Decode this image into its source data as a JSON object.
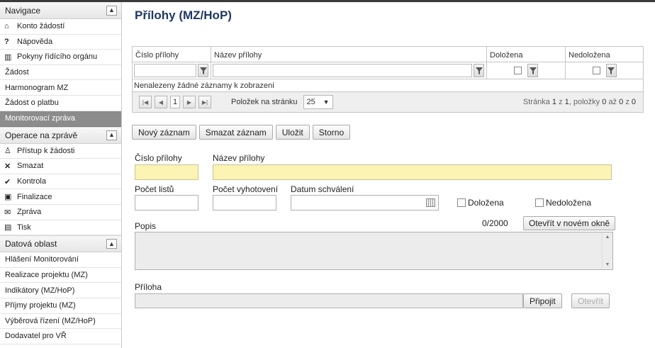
{
  "sidebar": {
    "navigation": {
      "title": "Navigace",
      "items": [
        {
          "label": "Konto žádostí",
          "icon": "home-icon"
        },
        {
          "label": "Nápověda",
          "icon": "help-icon"
        },
        {
          "label": "Pokyny řídícího orgánu",
          "icon": "book-icon"
        }
      ]
    },
    "links": [
      "Žádost",
      "Harmonogram MZ",
      "Žádost o platbu"
    ],
    "active_item": "Monitorovací zpráva",
    "operations": {
      "title": "Operace na zprávě",
      "items": [
        {
          "label": "Přístup k žádosti",
          "icon": "user-icon"
        },
        {
          "label": "Smazat",
          "icon": "delete-icon"
        },
        {
          "label": "Kontrola",
          "icon": "check-icon"
        },
        {
          "label": "Finalizace",
          "icon": "lock-icon"
        },
        {
          "label": "Zpráva",
          "icon": "mail-icon"
        },
        {
          "label": "Tisk",
          "icon": "print-icon"
        }
      ]
    },
    "data_area": {
      "title": "Datová oblast",
      "items": [
        "Hlášení Monitorování",
        "Realizace projektu (MZ)",
        "Indikátory (MZ/HoP)",
        "Příjmy projektu (MZ)",
        "Výběrová řízení (MZ/HoP)",
        "Dodavatel pro VŘ"
      ]
    }
  },
  "main": {
    "title": "Přílohy (MZ/HoP)",
    "grid": {
      "columns": [
        "Číslo přílohy",
        "Název přílohy",
        "Doložena",
        "Nedoložena"
      ],
      "empty_message": "Nenalezeny žádné záznamy k zobrazení",
      "pager": {
        "page": "1",
        "per_page_label": "Položek na stránku",
        "per_page": "25",
        "info_prefix": "Stránka",
        "page_current": "1",
        "info_of": "z",
        "page_total": "1",
        "info_items": ", položky",
        "item_from": "0",
        "info_to": "až",
        "item_to": "0",
        "item_total": "0"
      }
    },
    "toolbar": {
      "new": "Nový záznam",
      "delete": "Smazat záznam",
      "save": "Uložit",
      "cancel": "Storno"
    },
    "form": {
      "cislo_label": "Číslo přílohy",
      "nazev_label": "Název přílohy",
      "pocet_listu_label": "Počet listů",
      "pocet_vyhotoveni_label": "Počet vyhotovení",
      "datum_label": "Datum schválení",
      "dolozena_label": "Doložena",
      "nedolozena_label": "Nedoložena",
      "popis_label": "Popis",
      "counter": "0/2000",
      "open_window": "Otevřít v novém okně",
      "priloha_label": "Příloha",
      "attach": "Připojit",
      "open": "Otevřít"
    }
  }
}
